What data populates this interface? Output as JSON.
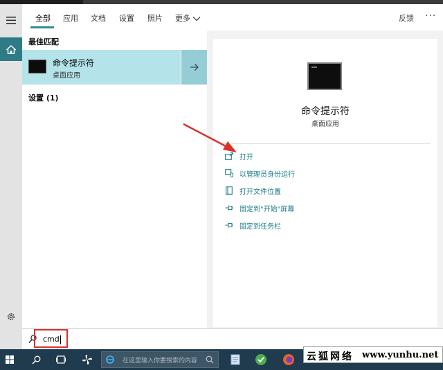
{
  "tabs": [
    {
      "label": "全部",
      "active": true
    },
    {
      "label": "应用"
    },
    {
      "label": "文档"
    },
    {
      "label": "设置"
    },
    {
      "label": "照片"
    },
    {
      "label": "更多"
    }
  ],
  "header_right": {
    "feedback": "反馈",
    "more_dots": "···"
  },
  "results": {
    "best_match_header": "最佳匹配",
    "best_match": {
      "name": "命令提示符",
      "type": "桌面应用"
    },
    "settings_header": "设置 (1)"
  },
  "preview": {
    "name": "命令提示符",
    "type": "桌面应用",
    "actions": [
      {
        "label": "打开",
        "icon": "open-icon"
      },
      {
        "label": "以管理员身份运行",
        "icon": "shield-run-icon"
      },
      {
        "label": "打开文件位置",
        "icon": "file-location-icon"
      },
      {
        "label": "固定到\"开始\"屏幕",
        "icon": "pin-icon"
      },
      {
        "label": "固定到任务栏",
        "icon": "pin-icon"
      }
    ]
  },
  "search": {
    "query": "cmd"
  },
  "taskbar": {
    "search_placeholder": "在这里输入你要搜索的内容"
  },
  "watermark": {
    "cn": "云狐网络",
    "url": "www.yunhu.net"
  },
  "colors": {
    "accent": "#2d8b97",
    "highlight": "#b4e4ea",
    "link": "#1f7e8b",
    "annotation_red": "#d8322a",
    "taskbar": "#1f3b4d"
  }
}
